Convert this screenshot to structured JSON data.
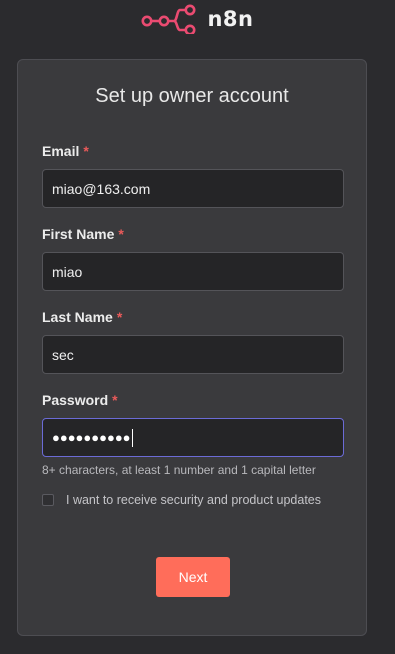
{
  "logo": {
    "text": "n8n",
    "icon": "n8n-logo-icon",
    "color": "#ea4b71"
  },
  "form": {
    "title": "Set up owner account",
    "required_marker": "*",
    "fields": [
      {
        "label": "Email",
        "value": "miao@163.com"
      },
      {
        "label": "First Name",
        "value": "miao"
      },
      {
        "label": "Last Name",
        "value": "sec"
      },
      {
        "label": "Password",
        "value": "●●●●●●●●●●"
      }
    ],
    "password_hint": "8+ characters, at least 1 number and 1 capital letter",
    "updates_checkbox": {
      "label": "I want to receive security and product updates",
      "checked": false
    },
    "next_label": "Next"
  },
  "colors": {
    "background": "#2b2b2e",
    "card": "#3a3a3d",
    "accent": "#ff6d5a",
    "required": "#ea5a5a",
    "focus_border": "#6b6bd6"
  }
}
